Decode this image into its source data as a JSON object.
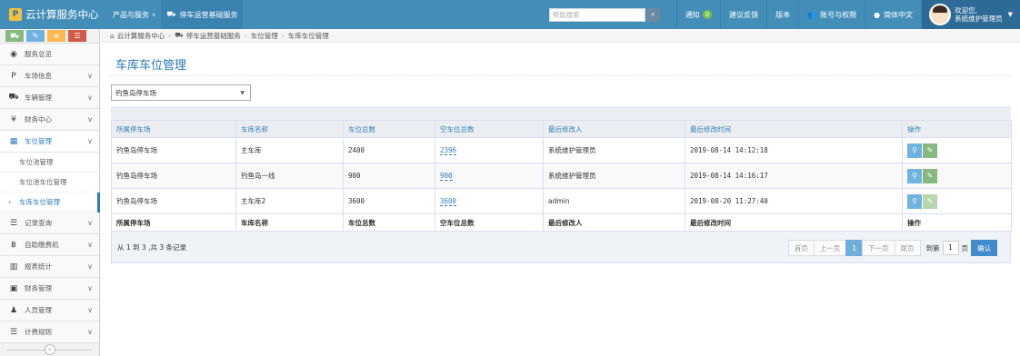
{
  "brand": {
    "logo": "P",
    "title": "云计算服务中心"
  },
  "nav": {
    "items": [
      {
        "label": "产品与服务",
        "caret": "∨"
      },
      {
        "label": "停车运营基础服务",
        "icon": "car-icon"
      }
    ]
  },
  "topbar": {
    "search_placeholder": "帮助搜索",
    "notice_label": "通知",
    "notice_count": "0",
    "feedback": "建议反馈",
    "version": "版本",
    "account": "账号与权限",
    "language": "简体中文",
    "welcome_line1": "欢迎您,",
    "welcome_line2": "系统维护管理员"
  },
  "sidebar": {
    "items": [
      {
        "label": "服务总览",
        "icon": "dashboard-icon",
        "glyph": "◉",
        "chev": ""
      },
      {
        "label": "车场信息",
        "icon": "parking-icon",
        "glyph": "P",
        "chev": "∨"
      },
      {
        "label": "车辆管理",
        "icon": "car-icon",
        "glyph": "⛟",
        "chev": "∨"
      },
      {
        "label": "财务中心",
        "icon": "yen-icon",
        "glyph": "¥",
        "chev": "∨"
      },
      {
        "label": "车位管理",
        "icon": "grid-icon",
        "glyph": "▦",
        "chev": "∨"
      }
    ],
    "submenu": [
      "车位池管理",
      "车位池车位管理",
      "车库车位管理"
    ],
    "items_after": [
      {
        "label": "记录查询",
        "icon": "list-icon",
        "glyph": "☰",
        "chev": "∨"
      },
      {
        "label": "自助缴费机",
        "icon": "bitcoin-icon",
        "glyph": "฿",
        "chev": "∨"
      },
      {
        "label": "报表统计",
        "icon": "bar-chart-icon",
        "glyph": "▥",
        "chev": "∨"
      },
      {
        "label": "财务管理",
        "icon": "money-icon",
        "glyph": "▣",
        "chev": "∨"
      },
      {
        "label": "人员管理",
        "icon": "person-icon",
        "glyph": "♟",
        "chev": "∨"
      },
      {
        "label": "计费规则",
        "icon": "list-icon",
        "glyph": "☰",
        "chev": "∨"
      }
    ]
  },
  "breadcrumb": {
    "home": "云计算服务中心",
    "service": "停车运营基础服务",
    "section": "车位管理",
    "current": "车库车位管理"
  },
  "main": {
    "title": "车库车位管理",
    "selected_lot": "钓鱼岛停车场"
  },
  "table": {
    "columns": [
      "所属停车场",
      "车库名称",
      "车位总数",
      "空车位总数",
      "最后修改人",
      "最后修改时间",
      "操作"
    ],
    "rows": [
      {
        "lot": "钓鱼岛停车场",
        "garage": "主车库",
        "total": "2400",
        "empty": "2396",
        "editor": "系统维护管理员",
        "time": "2019-08-14 14:12:18"
      },
      {
        "lot": "钓鱼岛停车场",
        "garage": "钓鱼岛一线",
        "total": "900",
        "empty": "900",
        "editor": "系统维护管理员",
        "time": "2019-08-14 14:16:17"
      },
      {
        "lot": "钓鱼岛停车场",
        "garage": "主车库2",
        "total": "3600",
        "empty": "3600",
        "editor": "admin",
        "time": "2019-08-20 11:27:40"
      }
    ]
  },
  "footer": {
    "records": "从 1 到 3 ,共 3 条记录",
    "first": "首页",
    "prev": "上一页",
    "current_page": "1",
    "next": "下一页",
    "last": "尾页",
    "goto_prefix": "到第",
    "goto_value": "1",
    "goto_suffix": "页",
    "confirm": "确认"
  },
  "colors": {
    "navbar": "#438eb9",
    "accent": "#2b7dbc",
    "info_button": "#6fb3e0",
    "edit_button": "#87b87f"
  }
}
